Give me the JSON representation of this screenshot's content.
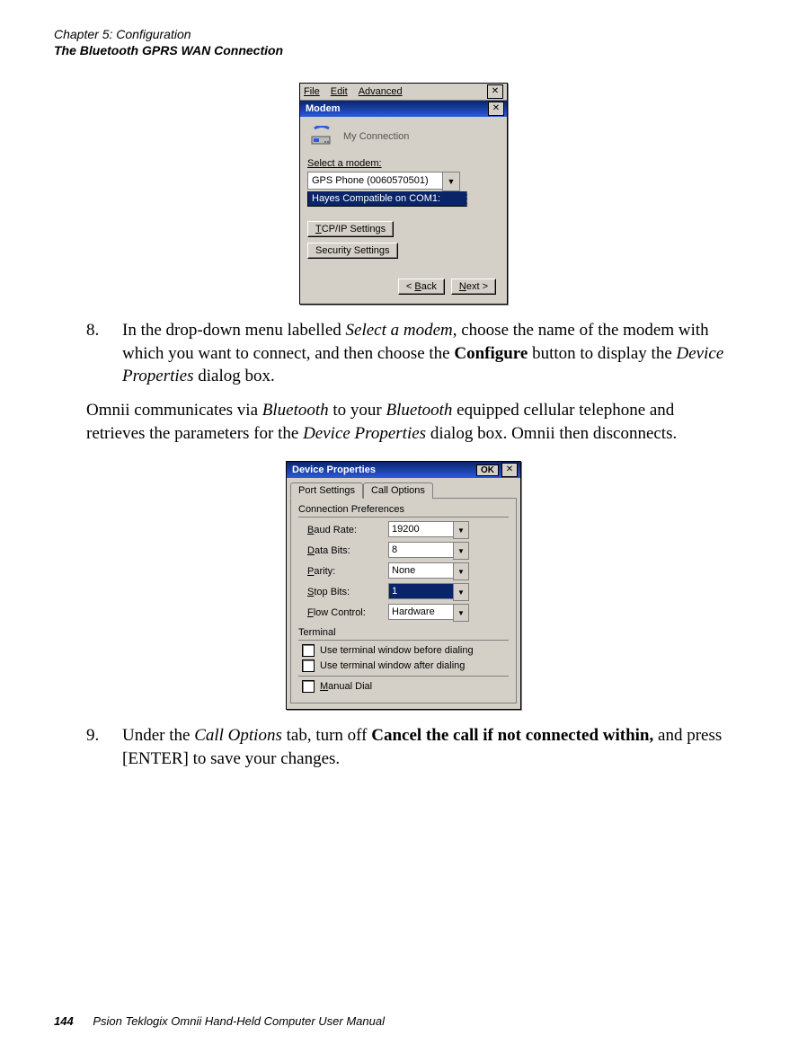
{
  "header": {
    "chapter": "Chapter 5:  Configuration",
    "section": "The Bluetooth GPRS WAN Connection"
  },
  "modem_window": {
    "menu": {
      "file": "File",
      "edit": "Edit",
      "advanced": "Advanced"
    },
    "title": "Modem",
    "connection_label": "My Connection",
    "select_label": "Select a modem:",
    "combo_value": "GPS Phone (0060570501)",
    "list_item": "Hayes Compatible on COM1:",
    "btn_tcpip": "TCP/IP Settings",
    "btn_security": "Security Settings",
    "btn_back": "< Back",
    "btn_next": "Next >"
  },
  "device_props": {
    "title": "Device Properties",
    "ok": "OK",
    "tabs": {
      "port": "Port Settings",
      "call": "Call Options"
    },
    "group_conn": "Connection Preferences",
    "rows": {
      "baud_label": "Baud Rate:",
      "baud_val": "19200",
      "data_label": "Data Bits:",
      "data_val": "8",
      "parity_label": "Parity:",
      "parity_val": "None",
      "stop_label": "Stop Bits:",
      "stop_val": "1",
      "flow_label": "Flow Control:",
      "flow_val": "Hardware"
    },
    "group_term": "Terminal",
    "cb_before": "Use terminal window before dialing",
    "cb_after": "Use terminal window after dialing",
    "cb_manual": "Manual Dial"
  },
  "body": {
    "step8_num": "8.",
    "step8_a": "In the drop-down menu labelled ",
    "step8_em1": "Select a modem",
    "step8_b": ", choose the name of the modem with which you want to connect, and then choose the ",
    "step8_strong": "Configure",
    "step8_c": " button to display the ",
    "step8_em2": "Device Properties",
    "step8_d": " dialog box.",
    "para_a": "Omnii communicates via ",
    "para_em1": "Bluetooth",
    "para_b": " to your ",
    "para_em2": "Bluetooth",
    "para_c": " equipped cellular telephone and retrieves the parameters for the ",
    "para_em3": "Device Properties",
    "para_d": " dialog box. Omnii then disconnects.",
    "step9_num": "9.",
    "step9_a": "Under the ",
    "step9_em1": "Call Options",
    "step9_b": " tab, turn off ",
    "step9_strong": "Cancel the call if not connected within,",
    "step9_c": " and press [ENTER] to save your changes."
  },
  "footer": {
    "page": "144",
    "text": "Psion Teklogix Omnii Hand-Held Computer User Manual"
  }
}
